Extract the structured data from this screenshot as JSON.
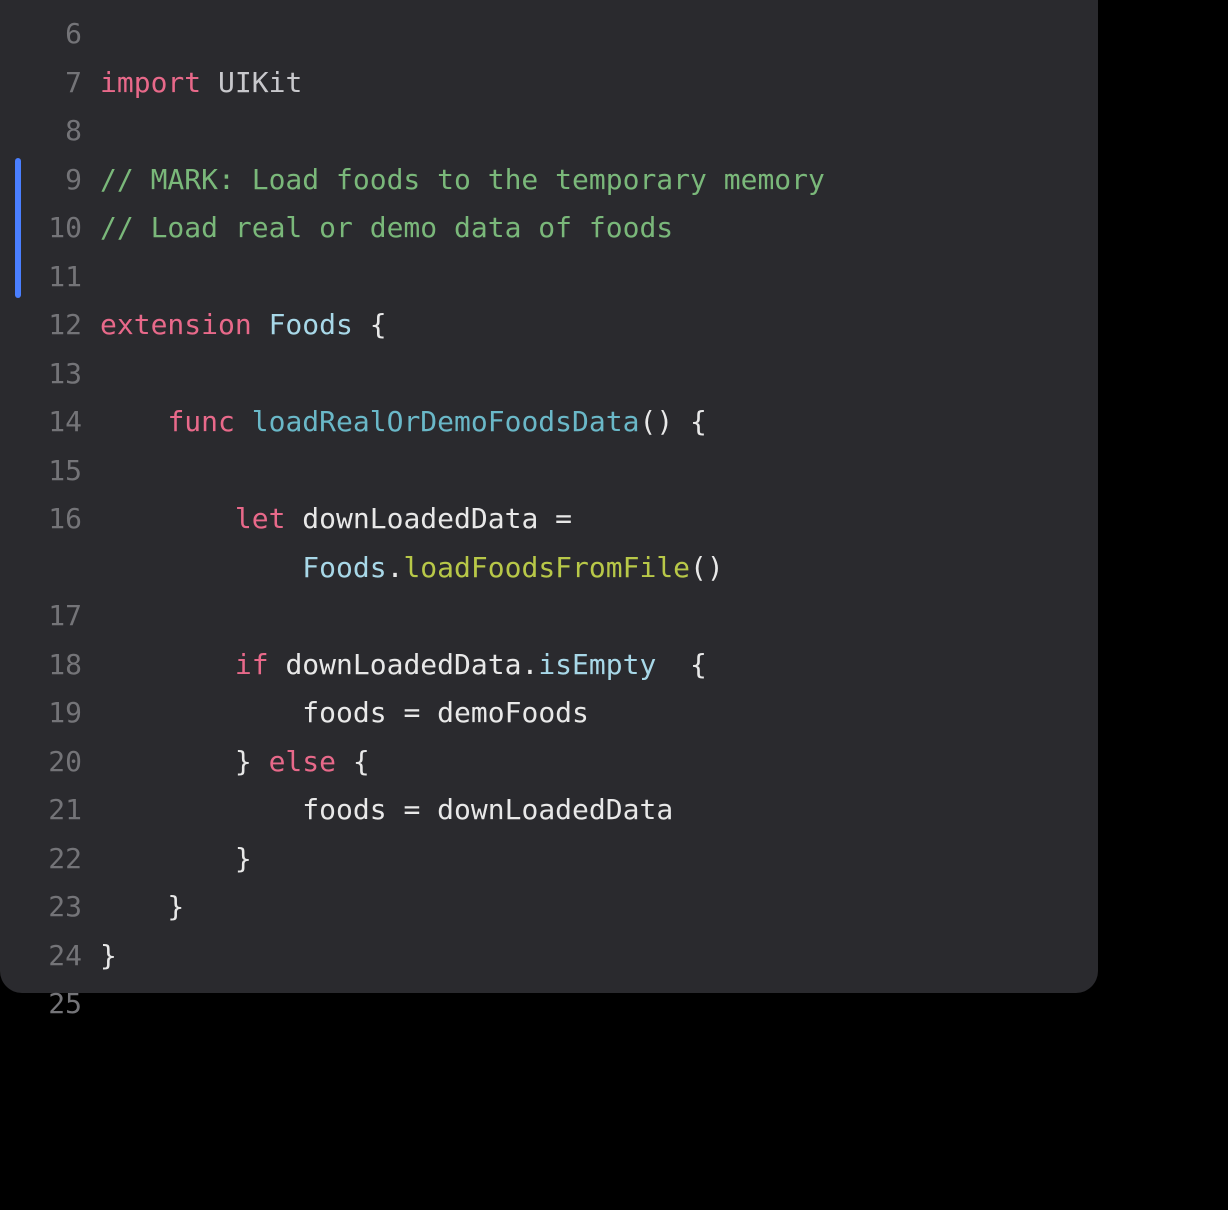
{
  "editor": {
    "lines": [
      {
        "num": "6",
        "segments": []
      },
      {
        "num": "7",
        "segments": [
          {
            "cls": "kw-import",
            "text": "import"
          },
          {
            "cls": "punct",
            "text": " "
          },
          {
            "cls": "module",
            "text": "UIKit"
          }
        ]
      },
      {
        "num": "8",
        "segments": []
      },
      {
        "num": "9",
        "segments": [
          {
            "cls": "comment",
            "text": "// MARK: Load foods to the temporary memory"
          }
        ]
      },
      {
        "num": "10",
        "segments": [
          {
            "cls": "comment",
            "text": "// Load real or demo data of foods"
          }
        ]
      },
      {
        "num": "11",
        "segments": []
      },
      {
        "num": "12",
        "segments": [
          {
            "cls": "kw-ext",
            "text": "extension"
          },
          {
            "cls": "punct",
            "text": " "
          },
          {
            "cls": "type",
            "text": "Foods"
          },
          {
            "cls": "punct",
            "text": " {"
          }
        ]
      },
      {
        "num": "13",
        "segments": []
      },
      {
        "num": "14",
        "segments": [
          {
            "cls": "punct",
            "text": "    "
          },
          {
            "cls": "kw-func",
            "text": "func"
          },
          {
            "cls": "punct",
            "text": " "
          },
          {
            "cls": "funcname",
            "text": "loadRealOrDemoFoodsData"
          },
          {
            "cls": "punct",
            "text": "() {"
          }
        ]
      },
      {
        "num": "15",
        "segments": []
      },
      {
        "num": "16",
        "segments": [
          {
            "cls": "punct",
            "text": "        "
          },
          {
            "cls": "kw-let",
            "text": "let"
          },
          {
            "cls": "punct",
            "text": " "
          },
          {
            "cls": "ident",
            "text": "downLoadedData"
          },
          {
            "cls": "punct",
            "text": " ="
          }
        ]
      },
      {
        "num": "",
        "wrap": true,
        "segments": [
          {
            "cls": "punct",
            "text": "            "
          },
          {
            "cls": "type",
            "text": "Foods"
          },
          {
            "cls": "punct",
            "text": "."
          },
          {
            "cls": "method",
            "text": "loadFoodsFromFile"
          },
          {
            "cls": "punct",
            "text": "()"
          }
        ]
      },
      {
        "num": "17",
        "segments": []
      },
      {
        "num": "18",
        "segments": [
          {
            "cls": "punct",
            "text": "        "
          },
          {
            "cls": "kw-if",
            "text": "if"
          },
          {
            "cls": "punct",
            "text": " "
          },
          {
            "cls": "ident",
            "text": "downLoadedData"
          },
          {
            "cls": "punct",
            "text": "."
          },
          {
            "cls": "prop",
            "text": "isEmpty"
          },
          {
            "cls": "punct",
            "text": "  {"
          }
        ]
      },
      {
        "num": "19",
        "segments": [
          {
            "cls": "punct",
            "text": "            "
          },
          {
            "cls": "ident",
            "text": "foods"
          },
          {
            "cls": "punct",
            "text": " = "
          },
          {
            "cls": "ident",
            "text": "demoFoods"
          }
        ]
      },
      {
        "num": "20",
        "segments": [
          {
            "cls": "punct",
            "text": "        } "
          },
          {
            "cls": "kw-else",
            "text": "else"
          },
          {
            "cls": "punct",
            "text": " {"
          }
        ]
      },
      {
        "num": "21",
        "segments": [
          {
            "cls": "punct",
            "text": "            "
          },
          {
            "cls": "ident",
            "text": "foods"
          },
          {
            "cls": "punct",
            "text": " = "
          },
          {
            "cls": "ident",
            "text": "downLoadedData"
          }
        ]
      },
      {
        "num": "22",
        "segments": [
          {
            "cls": "punct",
            "text": "        }"
          }
        ]
      },
      {
        "num": "23",
        "segments": [
          {
            "cls": "punct",
            "text": "    }"
          }
        ]
      },
      {
        "num": "24",
        "segments": [
          {
            "cls": "punct",
            "text": "}"
          }
        ]
      },
      {
        "num": "25",
        "segments": []
      }
    ]
  }
}
